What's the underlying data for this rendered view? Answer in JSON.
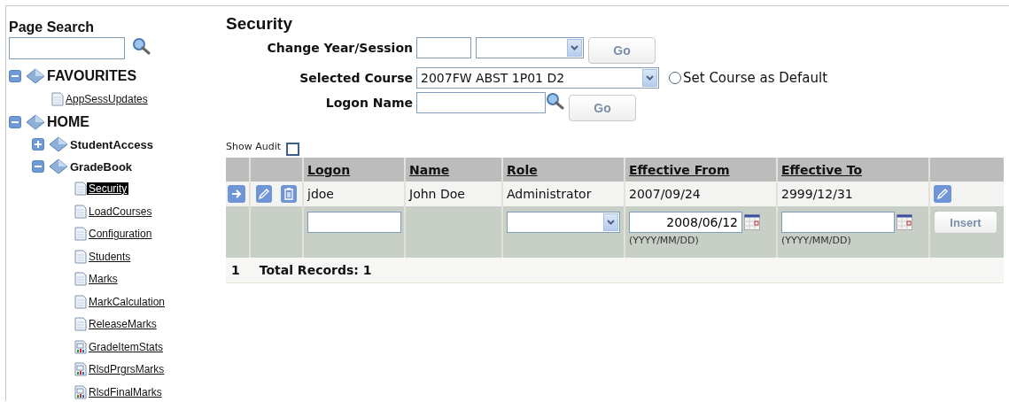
{
  "sidebar": {
    "title": "Page Search",
    "tree": [
      {
        "label": "FAVOURITES",
        "kind": "folder",
        "expanded": true,
        "children": [
          {
            "label": "AppSessUpdates",
            "kind": "page",
            "selected": false
          }
        ]
      },
      {
        "label": "HOME",
        "kind": "folder",
        "expanded": true,
        "children": [
          {
            "label": "StudentAccess",
            "kind": "folder",
            "expanded": false
          },
          {
            "label": "GradeBook",
            "kind": "folder",
            "expanded": true,
            "children": [
              {
                "label": "Security",
                "kind": "page",
                "selected": true
              },
              {
                "label": "LoadCourses",
                "kind": "page",
                "selected": false
              },
              {
                "label": "Configuration",
                "kind": "page",
                "selected": false
              },
              {
                "label": "Students",
                "kind": "page",
                "selected": false
              },
              {
                "label": "Marks",
                "kind": "page",
                "selected": false
              },
              {
                "label": "MarkCalculation",
                "kind": "page",
                "selected": false
              },
              {
                "label": "ReleaseMarks",
                "kind": "page",
                "selected": false
              },
              {
                "label": "GradeItemStats",
                "kind": "report",
                "selected": false
              },
              {
                "label": "RlsdPrgrsMarks",
                "kind": "report",
                "selected": false
              },
              {
                "label": "RlsdFinalMarks",
                "kind": "report",
                "selected": false
              }
            ]
          }
        ]
      }
    ]
  },
  "page_title": "Security",
  "form": {
    "year_session": {
      "label": "Change Year/Session",
      "go": "Go"
    },
    "course": {
      "label": "Selected Course",
      "value": "2007FW ABST 1P01 D2",
      "default_label": "Set Course as Default",
      "default_checked": false
    },
    "logon": {
      "label": "Logon Name",
      "go": "Go"
    },
    "show_audit": {
      "label": "Show Audit",
      "checked": false
    }
  },
  "table": {
    "columns": [
      "Logon",
      "Name",
      "Role",
      "Effective From",
      "Effective To"
    ],
    "rows": [
      {
        "cells": [
          "jdoe",
          "John Doe",
          "Administrator",
          "2007/09/24",
          "2999/12/31"
        ]
      }
    ],
    "insert_row": {
      "effective_from": "2008/06/12",
      "date_hint": [
        "(YYYY/MM/DD)",
        "(YYYY/MM/DD)"
      ],
      "button": "Insert"
    },
    "footer": {
      "page": "1",
      "total": "Total Records: 1"
    }
  }
}
